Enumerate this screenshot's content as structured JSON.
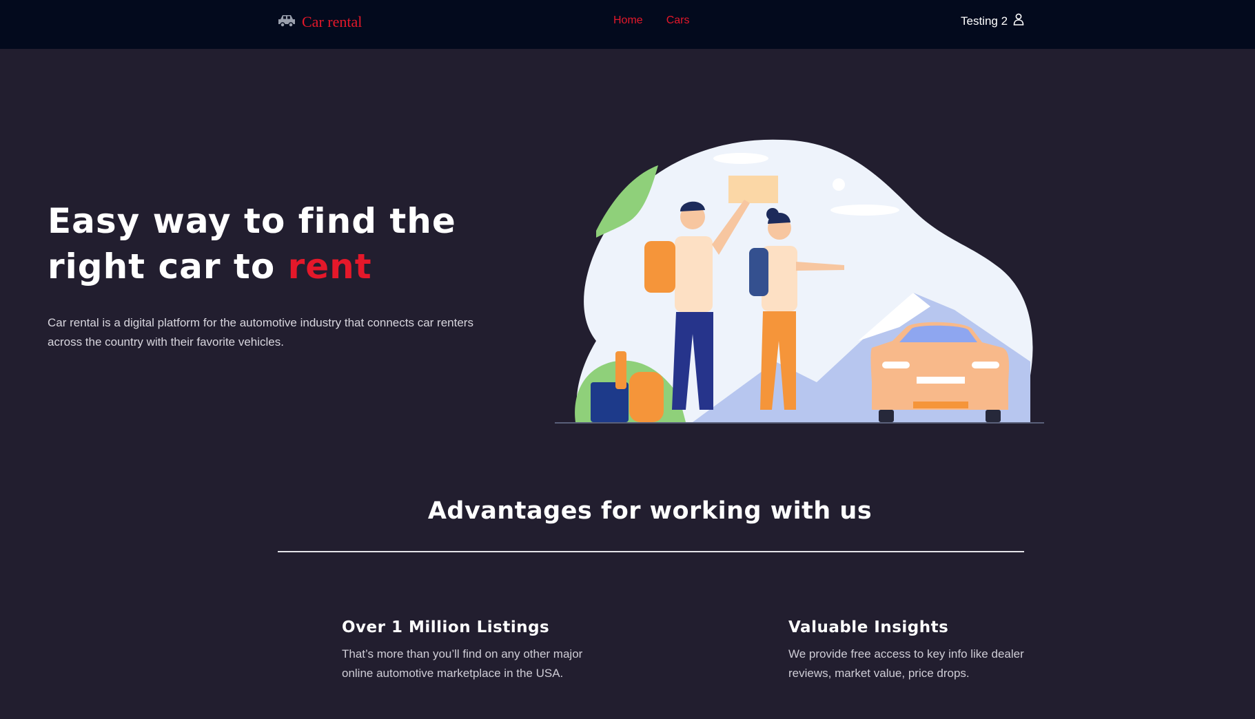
{
  "navbar": {
    "brand_icon": "car-icon",
    "brand_label": "Car rental",
    "links": [
      {
        "label": "Home"
      },
      {
        "label": "Cars"
      }
    ],
    "user_label": "Testing 2",
    "user_icon": "user-icon"
  },
  "hero": {
    "title_line1": "Easy way to find the",
    "title_line2_prefix": "right car to ",
    "title_line2_accent": "rent",
    "description": "Car rental is a digital platform for the automotive industry that connects car renters across the country with their favorite vehicles."
  },
  "advantages": {
    "title": "Advantages for working with us",
    "features": [
      {
        "title": "Over 1 Million Listings",
        "description": "That’s more than you’ll find on any other major online automotive marketplace in the USA."
      },
      {
        "title": "Valuable Insights",
        "description": "We provide free access to key info like dealer reviews, market value, price drops."
      }
    ]
  },
  "colors": {
    "accent": "#e4182a",
    "navbar_bg": "#030a1d",
    "page_bg": "#221e2f"
  }
}
